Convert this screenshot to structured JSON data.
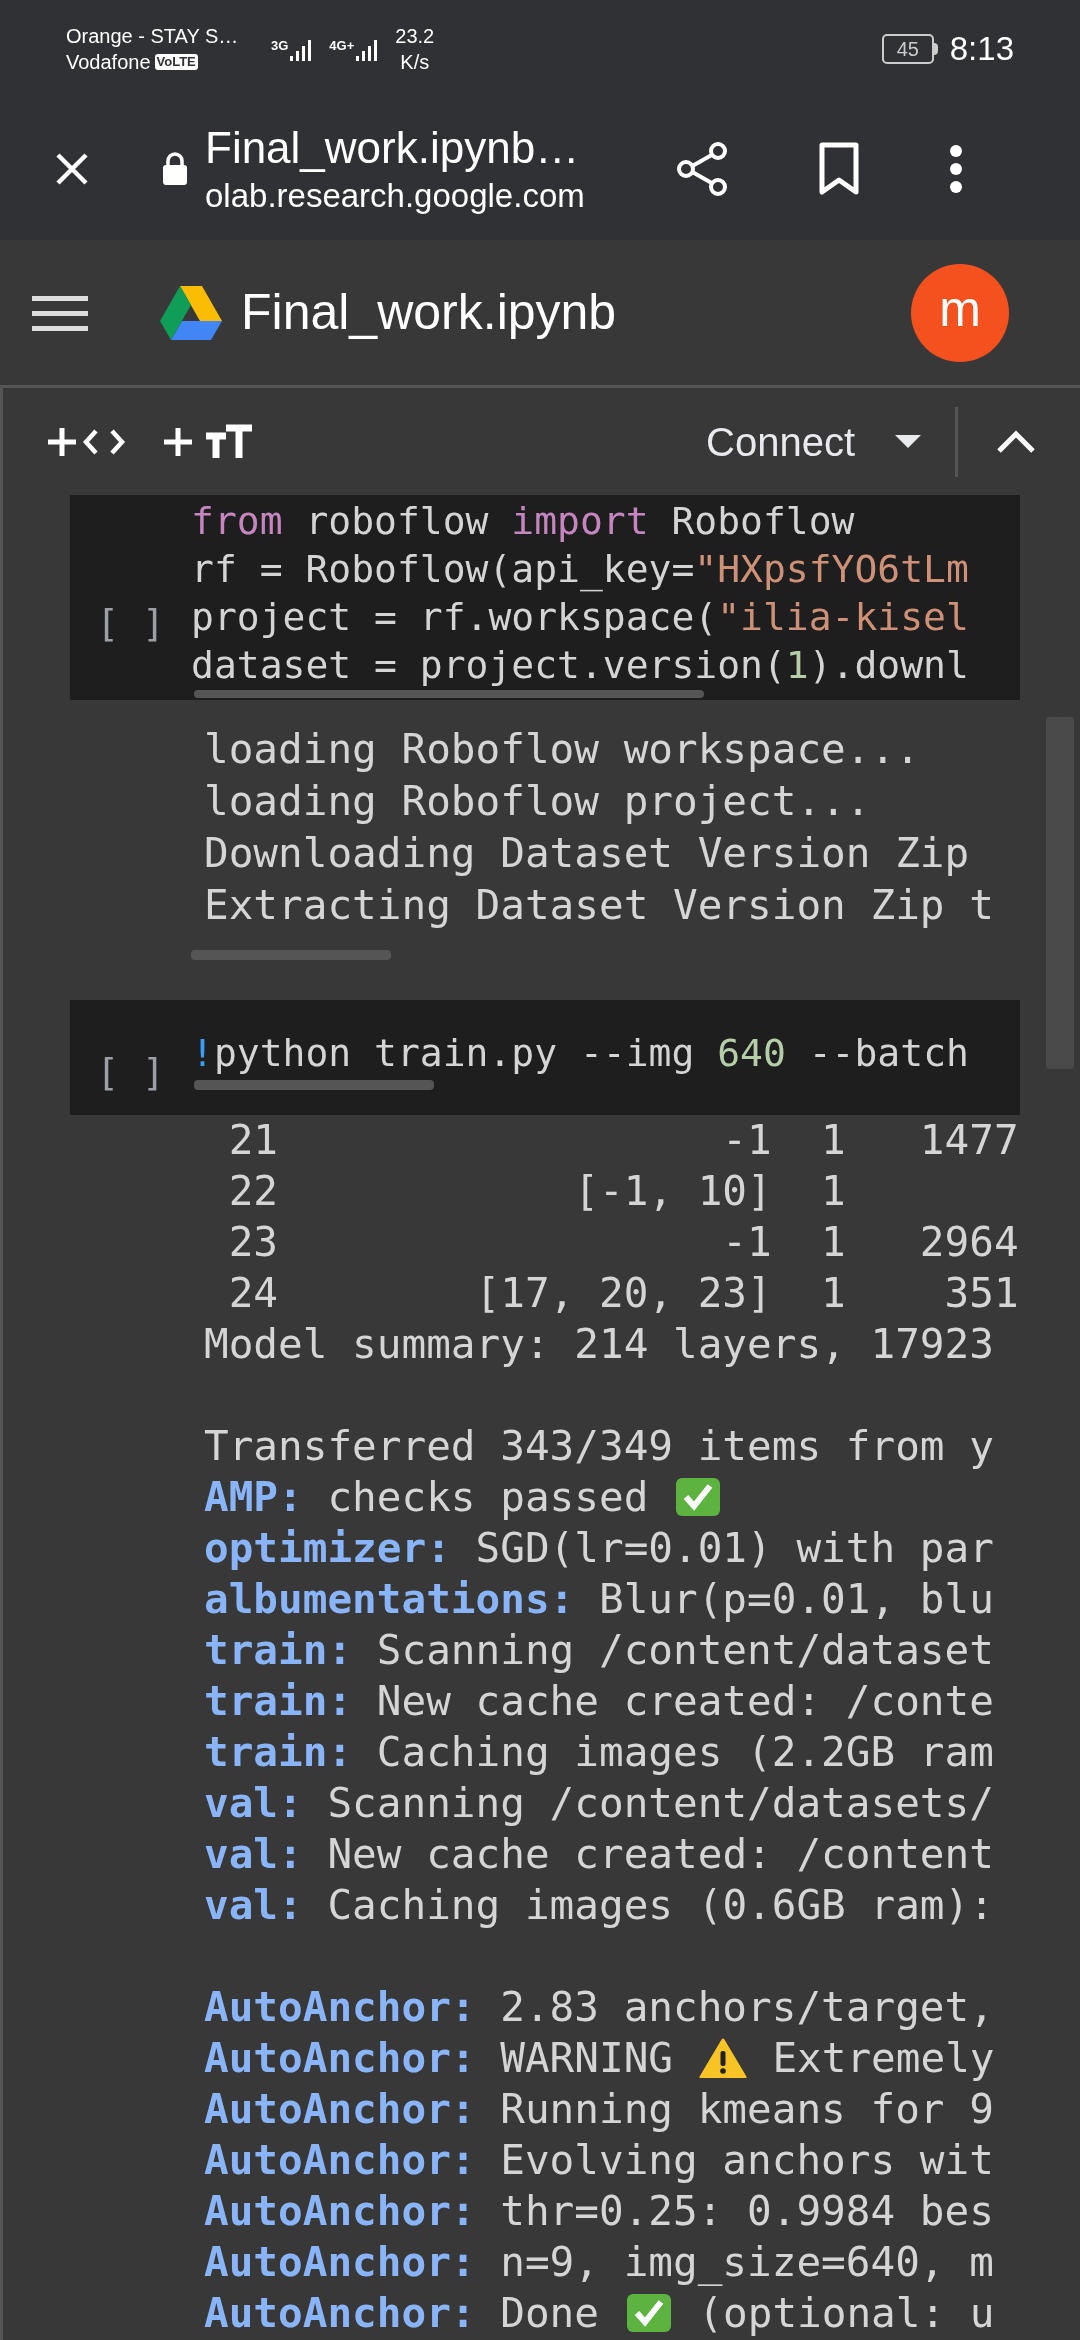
{
  "status_bar": {
    "carrier_1": "Orange - STAY S…",
    "carrier_2": "Vodafone",
    "volte_badge": "VoLTE",
    "network_1": "3G",
    "network_2": "4G+",
    "speed": "23.2",
    "speed_unit": "K/s",
    "battery": "45",
    "time": "8:13"
  },
  "browser_bar": {
    "title": "Final_work.ipynb…",
    "url": "olab.research.google.com"
  },
  "notebook_header": {
    "title": "Final_work.ipynb",
    "avatar": "m"
  },
  "toolbar": {
    "connect": "Connect"
  },
  "cells": [
    {
      "kind": "code",
      "prompt": "[ ]",
      "lines": [
        [
          {
            "text": "from",
            "kind": "keyword"
          },
          {
            "text": " roboflow ",
            "kind": "plain"
          },
          {
            "text": "import",
            "kind": "keyword"
          },
          {
            "text": " Roboflow",
            "kind": "plain"
          }
        ],
        [
          {
            "text": "rf = Roboflow(api_key=",
            "kind": "plain"
          },
          {
            "text": "\"HXpsfYO6tLm",
            "kind": "string"
          }
        ],
        [
          {
            "text": "project = rf.workspace(",
            "kind": "plain"
          },
          {
            "text": "\"ilia-kisel",
            "kind": "string"
          }
        ],
        [
          {
            "text": "dataset = project.version(",
            "kind": "plain"
          },
          {
            "text": "1",
            "kind": "number"
          },
          {
            "text": ").downl",
            "kind": "plain"
          }
        ]
      ]
    },
    {
      "kind": "output",
      "lines": [
        {
          "kind": "text",
          "segments": [
            {
              "text": "loading Roboflow workspace...",
              "kind": "plain"
            }
          ]
        },
        {
          "kind": "text",
          "segments": [
            {
              "text": "loading Roboflow project...",
              "kind": "plain"
            }
          ]
        },
        {
          "kind": "text",
          "segments": [
            {
              "text": "Downloading Dataset Version Zip",
              "kind": "plain"
            }
          ]
        },
        {
          "kind": "text",
          "segments": [
            {
              "text": "Extracting Dataset Version Zip t",
              "kind": "plain"
            }
          ]
        }
      ]
    },
    {
      "kind": "code",
      "prompt": "[ ]",
      "lines": [
        [
          {
            "text": "!",
            "kind": "magic"
          },
          {
            "text": "python train.py --img ",
            "kind": "plain"
          },
          {
            "text": "640",
            "kind": "number"
          },
          {
            "text": " --batch",
            "kind": "plain"
          }
        ]
      ]
    },
    {
      "kind": "output",
      "lines": [
        {
          "kind": "text",
          "segments": [
            {
              "text": " 21                  -1  1   1477",
              "kind": "plain"
            }
          ]
        },
        {
          "kind": "text",
          "segments": [
            {
              "text": " 22            [-1, 10]  1",
              "kind": "plain"
            }
          ]
        },
        {
          "kind": "text",
          "segments": [
            {
              "text": " 23                  -1  1   2964",
              "kind": "plain"
            }
          ]
        },
        {
          "kind": "text",
          "segments": [
            {
              "text": " 24        [17, 20, 23]  1    351",
              "kind": "plain"
            }
          ]
        },
        {
          "kind": "text",
          "segments": [
            {
              "text": "Model summary: 214 layers, 17923",
              "kind": "plain"
            }
          ]
        },
        {
          "kind": "blank"
        },
        {
          "kind": "text",
          "segments": [
            {
              "text": "Transferred 343/349 items from y",
              "kind": "plain"
            }
          ]
        },
        {
          "kind": "text",
          "segments": [
            {
              "text": "AMP:",
              "kind": "label"
            },
            {
              "text": " checks passed ",
              "kind": "plain"
            },
            {
              "kind": "check"
            }
          ]
        },
        {
          "kind": "text",
          "segments": [
            {
              "text": "optimizer:",
              "kind": "label"
            },
            {
              "text": " SGD(lr=0.01) with par",
              "kind": "plain"
            }
          ]
        },
        {
          "kind": "text",
          "segments": [
            {
              "text": "albumentations:",
              "kind": "label"
            },
            {
              "text": " Blur(p=0.01, blu",
              "kind": "plain"
            }
          ]
        },
        {
          "kind": "text",
          "segments": [
            {
              "text": "train:",
              "kind": "label"
            },
            {
              "text": " Scanning /content/dataset",
              "kind": "plain"
            }
          ]
        },
        {
          "kind": "text",
          "segments": [
            {
              "text": "train:",
              "kind": "label"
            },
            {
              "text": " New cache created: /conte",
              "kind": "plain"
            }
          ]
        },
        {
          "kind": "text",
          "segments": [
            {
              "text": "train:",
              "kind": "label"
            },
            {
              "text": " Caching images (2.2GB ram",
              "kind": "plain"
            }
          ]
        },
        {
          "kind": "text",
          "segments": [
            {
              "text": "val:",
              "kind": "label"
            },
            {
              "text": " Scanning /content/datasets/",
              "kind": "plain"
            }
          ]
        },
        {
          "kind": "text",
          "segments": [
            {
              "text": "val:",
              "kind": "label"
            },
            {
              "text": " New cache created: /content",
              "kind": "plain"
            }
          ]
        },
        {
          "kind": "text",
          "segments": [
            {
              "text": "val:",
              "kind": "label"
            },
            {
              "text": " Caching images (0.6GB ram):",
              "kind": "plain"
            }
          ]
        },
        {
          "kind": "blank"
        },
        {
          "kind": "text",
          "segments": [
            {
              "text": "AutoAnchor:",
              "kind": "label"
            },
            {
              "text": " 2.83 anchors/target,",
              "kind": "plain"
            }
          ]
        },
        {
          "kind": "text",
          "segments": [
            {
              "text": "AutoAnchor:",
              "kind": "label"
            },
            {
              "text": " WARNING ",
              "kind": "plain"
            },
            {
              "kind": "warning"
            },
            {
              "text": " Extremely",
              "kind": "plain"
            }
          ]
        },
        {
          "kind": "text",
          "segments": [
            {
              "text": "AutoAnchor:",
              "kind": "label"
            },
            {
              "text": " Running kmeans for 9",
              "kind": "plain"
            }
          ]
        },
        {
          "kind": "text",
          "segments": [
            {
              "text": "AutoAnchor:",
              "kind": "label"
            },
            {
              "text": " Evolving anchors wit",
              "kind": "plain"
            }
          ]
        },
        {
          "kind": "text",
          "segments": [
            {
              "text": "AutoAnchor:",
              "kind": "label"
            },
            {
              "text": " thr=0.25: 0.9984 bes",
              "kind": "plain"
            }
          ]
        },
        {
          "kind": "text",
          "segments": [
            {
              "text": "AutoAnchor:",
              "kind": "label"
            },
            {
              "text": " n=9, img_size=640, m",
              "kind": "plain"
            }
          ]
        },
        {
          "kind": "text",
          "segments": [
            {
              "text": "AutoAnchor:",
              "kind": "label"
            },
            {
              "text": " Done ",
              "kind": "plain"
            },
            {
              "kind": "check"
            },
            {
              "text": " (optional: u",
              "kind": "plain"
            }
          ]
        }
      ]
    }
  ]
}
